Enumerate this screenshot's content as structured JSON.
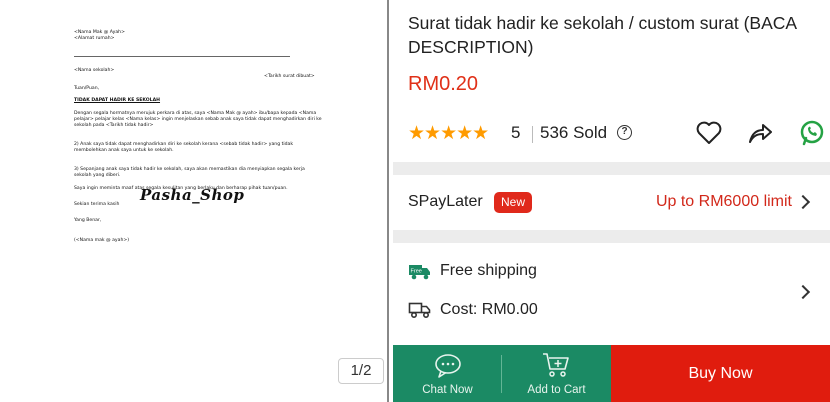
{
  "gallery": {
    "counter": "1/2",
    "watermark": "Pasha_Shop",
    "document": {
      "lines": [
        "<Nama Mak @ Ayah>",
        "<Alamat rumah>",
        "<Nama sekolah>",
        "<Tarikh surat dibuat>",
        "Tuan/Puan,",
        "TIDAK DAPAT HADIR KE SEKOLAH",
        "Dengan segala hormatnya merujuk perkara di atas, saya <Nama Mak @ ayah> ibu/bapa kepada <Nama pelajar> pelajar kelas <Nama kelas> ingin menjelaskan sebab anak saya tidak dapat menghadirkan diri ke sekolah pada <Tarikh tidak hadir>",
        "2) Anak saya tidak dapat menghadirkan diri ke sekolah kerana <sebab tidak hadir> yang tidak membolehkan anak saya untuk ke sekolah.",
        "3) Sepanjang anak saya tidak hadir ke sekolah, saya akan memastikan dia menyiapkan segala kerja sekolah yang diberi.",
        "Saya ingin meminta maaf atas segala kesulitan yang berlaku dan berharap pihak tuan/puan.",
        "Sekian terima kasih",
        "Yang Benar,",
        "(<Nama mak @ ayah>)"
      ]
    }
  },
  "product": {
    "title": "Surat tidak hadir ke sekolah / custom surat (BACA DESCRIPTION)",
    "price": "RM0.20",
    "stars": "★★★★★",
    "rating": "5",
    "sold": "536 Sold",
    "info_icon": "?"
  },
  "spaylater": {
    "label": "SPayLater",
    "badge": "New",
    "limit": "Up to RM6000 limit"
  },
  "shipping": {
    "free_label": "Free shipping",
    "free_badge": "Free",
    "cost_label": "Cost: RM0.00"
  },
  "actions": {
    "chat_label": "Chat Now",
    "cart_label": "Add to Cart",
    "buy_label": "Buy Now"
  },
  "colors": {
    "price": "#e03018",
    "stars": "#ff9b00",
    "green_bar": "#1b8a64",
    "buy_red": "#e01c0e",
    "whatsapp": "#25a244"
  },
  "icons": [
    "heart-icon",
    "share-icon",
    "whatsapp-icon",
    "chevron-right-icon",
    "truck-icon",
    "chat-icon",
    "cart-icon",
    "info-icon"
  ]
}
